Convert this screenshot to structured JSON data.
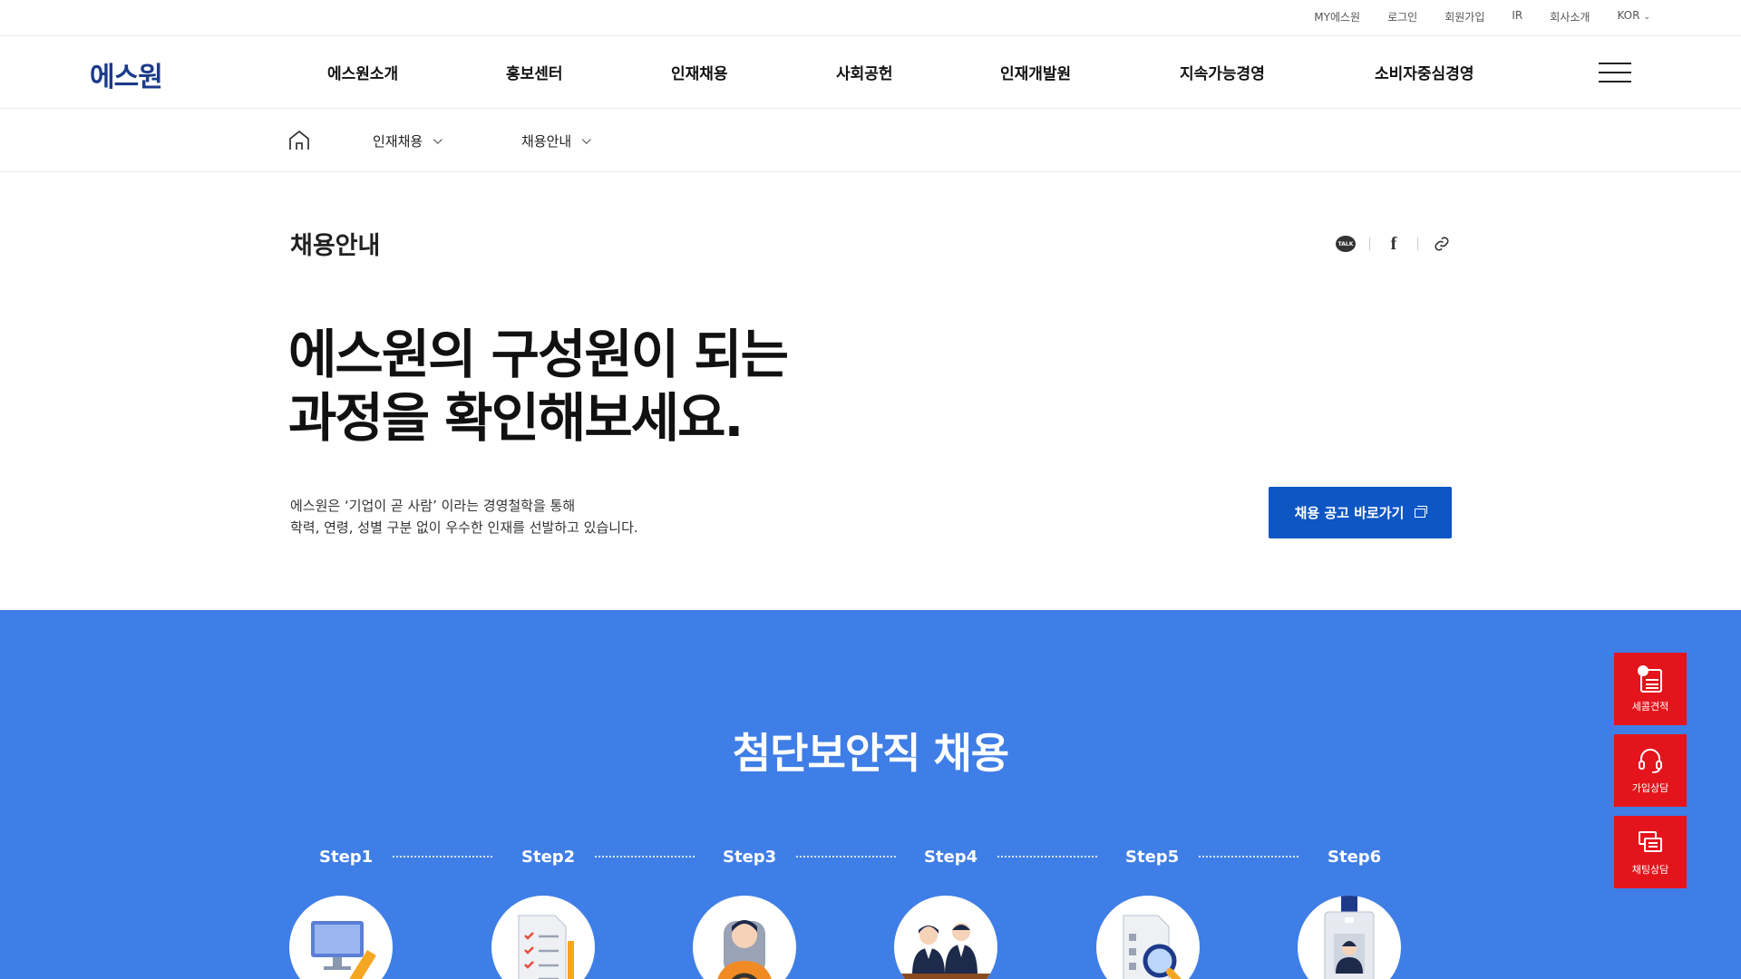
{
  "util": {
    "links": [
      "MY에스원",
      "로그인",
      "회원가입",
      "IR",
      "회사소개",
      "KOR"
    ]
  },
  "header": {
    "logo": "에스원",
    "menu": [
      "에스원소개",
      "홍보센터",
      "인재채용",
      "사회공헌",
      "인재개발원",
      "지속가능경영",
      "소비자중심경영"
    ]
  },
  "breadcrumb": {
    "items": [
      "인재채용",
      "채용안내"
    ]
  },
  "intro": {
    "page_title": "채용안내",
    "share_talk": "TALK",
    "share_fb": "f",
    "headline_line1": "에스원의 구성원이 되는",
    "headline_line2": "과정을 확인해보세요.",
    "desc_line1": "에스원은 ‘기업이 곧 사람’ 이라는 경영철학을 통해",
    "desc_line2": "학력, 연령, 성별 구분 없이 우수한 인재를 선발하고 있습니다.",
    "cta_label": "채용 공고 바로가기"
  },
  "process": {
    "title": "첨단보안직 채용",
    "steps": [
      "Step1",
      "Step2",
      "Step3",
      "Step4",
      "Step5",
      "Step6"
    ],
    "step_icons": [
      "computer-pencil-icon",
      "document-checklist-icon",
      "driver-icon",
      "interview-icon",
      "document-search-icon",
      "id-badge-icon"
    ]
  },
  "floating": {
    "items": [
      "세콤견적",
      "가입상담",
      "채팅상담"
    ]
  },
  "colors": {
    "brand_blue": "#0d56c4",
    "section_blue": "#3f7ee6",
    "float_red": "#e4141c",
    "logo_navy": "#1a3a8a"
  }
}
